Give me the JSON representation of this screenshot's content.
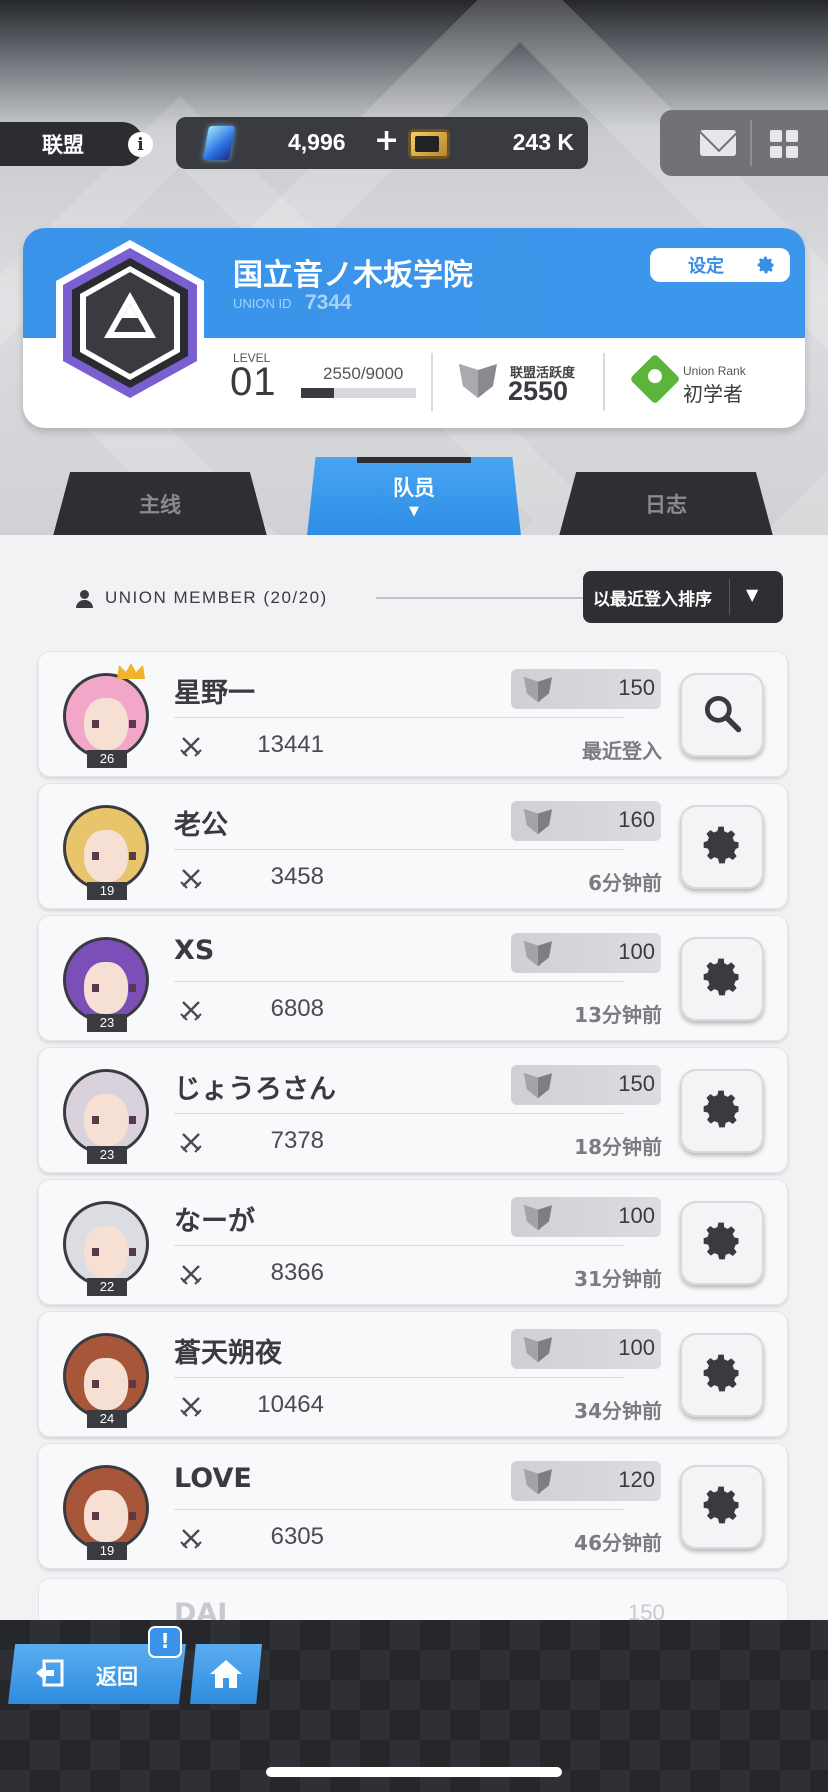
{
  "header": {
    "section_label": "联盟",
    "info_icon": "info-icon",
    "gems": {
      "icon": "gem-icon",
      "value": "4,996",
      "plus": "+"
    },
    "tickets": {
      "icon": "ticket-icon",
      "value": "243 K"
    },
    "mail_icon": "mail-icon",
    "menu_icon": "grid-menu-icon"
  },
  "union": {
    "name": "国立音ノ木坂学院",
    "id_label": "UNION ID",
    "id_value": "7344",
    "settings_label": "设定",
    "level_label": "LEVEL",
    "level_value": "01",
    "exp_text": "2550/9000",
    "exp_progress": 0.283,
    "activity_label": "联盟活跃度",
    "activity_value": "2550",
    "rank_label": "Union Rank",
    "rank_value": "初学者"
  },
  "tabs": [
    {
      "label": "主线",
      "active": false
    },
    {
      "label": "队员",
      "active": true,
      "caret": "▼"
    },
    {
      "label": "日志",
      "active": false
    }
  ],
  "members_header": {
    "label": "UNION MEMBER  (20/20)",
    "sort_label": "以最近登入排序",
    "sort_arrow": "▼"
  },
  "members": [
    {
      "name": "星野一",
      "level": "26",
      "activity": "150",
      "power": "13441",
      "last_login": "最近登入",
      "action": "search",
      "leader": true
    },
    {
      "name": "老公",
      "level": "19",
      "activity": "160",
      "power": "3458",
      "last_login": "6分钟前",
      "action": "settings"
    },
    {
      "name": "XS",
      "level": "23",
      "activity": "100",
      "power": "6808",
      "last_login": "13分钟前",
      "action": "settings"
    },
    {
      "name": "じょうろさん",
      "level": "23",
      "activity": "150",
      "power": "7378",
      "last_login": "18分钟前",
      "action": "settings"
    },
    {
      "name": "なーが",
      "level": "22",
      "activity": "100",
      "power": "8366",
      "last_login": "31分钟前",
      "action": "settings"
    },
    {
      "name": "蒼天朔夜",
      "level": "24",
      "activity": "100",
      "power": "10464",
      "last_login": "34分钟前",
      "action": "settings"
    },
    {
      "name": "LOVE",
      "level": "19",
      "activity": "120",
      "power": "6305",
      "last_login": "46分钟前",
      "action": "settings"
    }
  ],
  "partial_member": {
    "name": "DAI",
    "activity": "150"
  },
  "bottom": {
    "back_label": "返回",
    "notify": "!",
    "home_icon": "home-icon"
  },
  "colors": {
    "accent_blue": "#3a93e8",
    "dark": "#2e2f33",
    "rank_green": "#5bb53a",
    "crown_gold": "#f2b22a"
  }
}
